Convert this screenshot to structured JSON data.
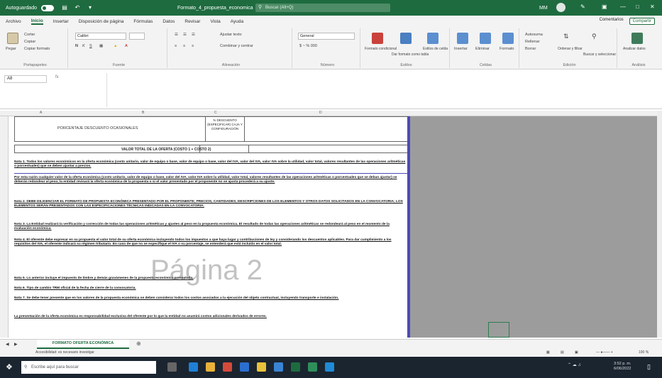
{
  "titlebar": {
    "autosave_label": "Autoguardado",
    "document_title": "Formato_4_propuesta_economica",
    "search_placeholder": "Buscar (Alt+Q)",
    "user_initials": "MM"
  },
  "ribbon_tabs": [
    "Archivo",
    "Inicio",
    "Insertar",
    "Disposición de página",
    "Fórmulas",
    "Datos",
    "Revisar",
    "Vista",
    "Ayuda"
  ],
  "ribbon_right": {
    "comments": "Comentarios",
    "share": "Compartir"
  },
  "ribbon_groups": {
    "clipboard": {
      "label": "Portapapeles",
      "paste": "Pegar",
      "cut": "Cortar",
      "copy": "Copiar",
      "format_painter": "Copiar formato"
    },
    "font": {
      "label": "Fuente",
      "font_name": "Calibri"
    },
    "alignment": {
      "label": "Alineación",
      "wrap": "Ajustar texto",
      "merge": "Combinar y centrar"
    },
    "number": {
      "label": "Número",
      "format": "General"
    },
    "styles": {
      "label": "Estilos",
      "conditional": "Formato condicional",
      "table": "Dar formato como tabla",
      "cell_styles": "Estilos de celda"
    },
    "cells": {
      "label": "Celdas",
      "insert": "Insertar",
      "delete": "Eliminar",
      "format": "Formato"
    },
    "editing": {
      "label": "Edición",
      "autosum": "Autosuma",
      "fill": "Rellenar",
      "clear": "Borrar",
      "sort": "Ordenar y filtrar",
      "find": "Buscar y seleccionar"
    },
    "analysis": {
      "label": "Análisis",
      "analyze": "Analizar datos"
    }
  },
  "formula_bar": {
    "name_box": "A8",
    "fx": "fx"
  },
  "sheet": {
    "header_label": "PORCENTAJE DESCUENTO OCASIONALES",
    "column_box": "% DESCUENTO (ESPECIFICAR) CAJA Y CONFIGURACIÓN",
    "total_label": "VALOR TOTAL DE LA OFERTA (COSTO 1 + COSTO 2)",
    "notes": [
      "Nota 1. Todos los valores económicos en la oferta económica (costo unitario, valor de equipo o base, valor de equipo o base, valor del IVA, valor del IVA, valor IVA sobre la utilidad, valor total, valores resultantes de las operaciones aritméticas o porcentuales) que se deben ajustar a precios.",
      "Por esta razón cualquier valor de la oferta económica (costo unitario, valor de equipo o base, valor del IVA, valor IVA sobre la utilidad, valor total, valores resultantes de las operaciones aritméticas o porcentuales que se deban ajustar) se deberán redondear al peso, la entidad revisará la oferta económica de la propuesta o si el valor presentado por el proponente no se ajusta procederá a su ajuste.",
      "Nota 2. DEBE DILIGENCIAR EL FORMATO DE PROPUESTA ECONÓMICA PRESENTADO POR EL PROPONENTE; PRECIOS, CANTIDADES, DESCRIPCIONES DE LOS ELEMENTOS Y OTROS DATOS SOLICITADOS EN LA CONVOCATORIA; LOS ELEMENTOS SERÁN PRESENTADOS CON LAS ESPECIFICACIONES TÉCNICAS INDICADAS EN LA CONVOCATORIA.",
      "Nota 3. La Entidad realizará la verificación y corrección de todas las operaciones aritméticas y ajustes al peso en la propuesta económica. El resultado de todas las operaciones aritméticas se redondeará al peso en el momento de la evaluación económica.",
      "Nota 4. El oferente debe expresar en su propuesta el valor total de su oferta económica incluyendo todos los impuestos a que haya lugar y contribuciones de ley y considerando los descuentos aplicables. Para dar cumplimiento a los requisitos del IVA, el oferente indicará su régimen tributario. En caso de que no se especifique el IVA o su porcentaje, se entenderá que está incluido en el valor total.",
      "Nota 5. Lo anterior incluye el impuesto de timbre y demás gravámenes de la propuesta económica presentada.",
      "Nota 6. Tipo de cambio TRM oficial de la fecha de cierre de la convocatoria.",
      "Nota 7. Se debe tener presente que en los valores de la propuesta económica se deben considerar todos los costos asociados a la ejecución del objeto contractual, incluyendo transporte e instalación.",
      "La presentación de la oferta económica es responsabilidad exclusiva del oferente por lo que la entidad no asumirá costos adicionales derivados de errores."
    ]
  },
  "watermark": "Página 2",
  "sheet_tab": "FORMATO OFERTA ECONÓMICA",
  "status": {
    "accessibility": "Accesibilidad: es necesario investigar",
    "zoom": "100 %"
  },
  "taskbar": {
    "search_placeholder": "Escribe aquí para buscar",
    "time": "3:52 p. m.",
    "date": "6/06/2022"
  }
}
